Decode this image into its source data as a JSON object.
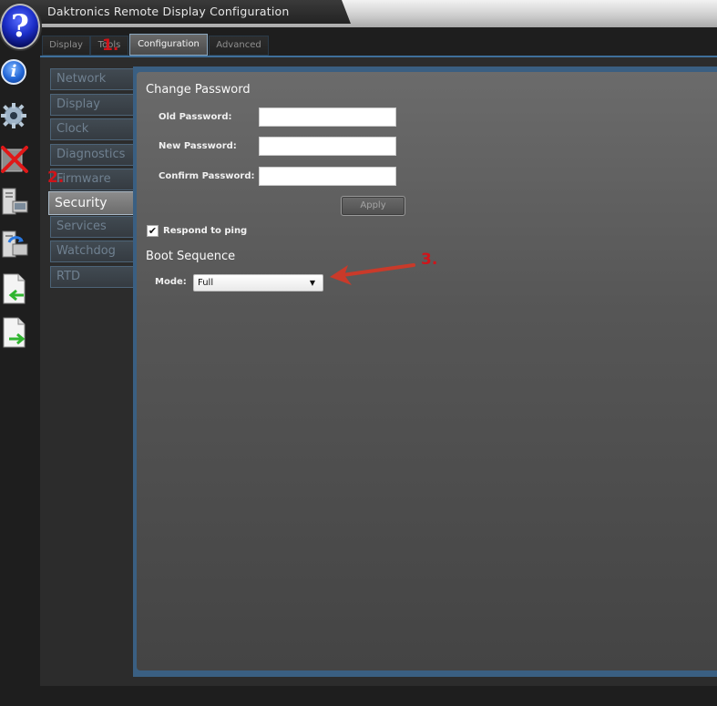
{
  "window": {
    "title": "Daktronics Remote Display Configuration",
    "help_glyph": "?"
  },
  "icon_strip": [
    {
      "icon": "info-icon",
      "glyph": "i"
    },
    {
      "icon": "gear-icon"
    },
    {
      "icon": "close-x-icon"
    },
    {
      "icon": "computer-icon"
    },
    {
      "icon": "computer-sync-icon"
    },
    {
      "icon": "document-import-icon"
    },
    {
      "icon": "document-export-icon"
    }
  ],
  "tabs": [
    {
      "label": "Display",
      "active": false
    },
    {
      "label": "Tools",
      "active": false
    },
    {
      "label": "Configuration",
      "active": true
    },
    {
      "label": "Advanced",
      "active": false
    }
  ],
  "sidebar": {
    "items": [
      {
        "label": "Network",
        "active": false
      },
      {
        "label": "Display",
        "active": false
      },
      {
        "label": "Clock",
        "active": false
      },
      {
        "label": "Diagnostics",
        "active": false
      },
      {
        "label": "Firmware",
        "active": false
      },
      {
        "label": "Security",
        "active": true
      },
      {
        "label": "Services",
        "active": false
      },
      {
        "label": "Watchdog",
        "active": false
      },
      {
        "label": "RTD",
        "active": false
      }
    ]
  },
  "change_password": {
    "title": "Change Password",
    "old_label": "Old Password:",
    "old_value": "",
    "new_label": "New Password:",
    "new_value": "",
    "confirm_label": "Confirm Password:",
    "confirm_value": "",
    "apply_label": "Apply"
  },
  "ping": {
    "label": "Respond to ping",
    "checked": true,
    "check_glyph": "✔"
  },
  "boot_sequence": {
    "title": "Boot Sequence",
    "mode_label": "Mode:",
    "mode_value": "Full",
    "caret_glyph": "▼"
  },
  "annotations": {
    "step1": "1.",
    "step2": "2.",
    "step3": "3.",
    "color": "#d0141a"
  },
  "colors": {
    "accent_blue": "#3f6f9a",
    "panel_gray": "#565656"
  }
}
